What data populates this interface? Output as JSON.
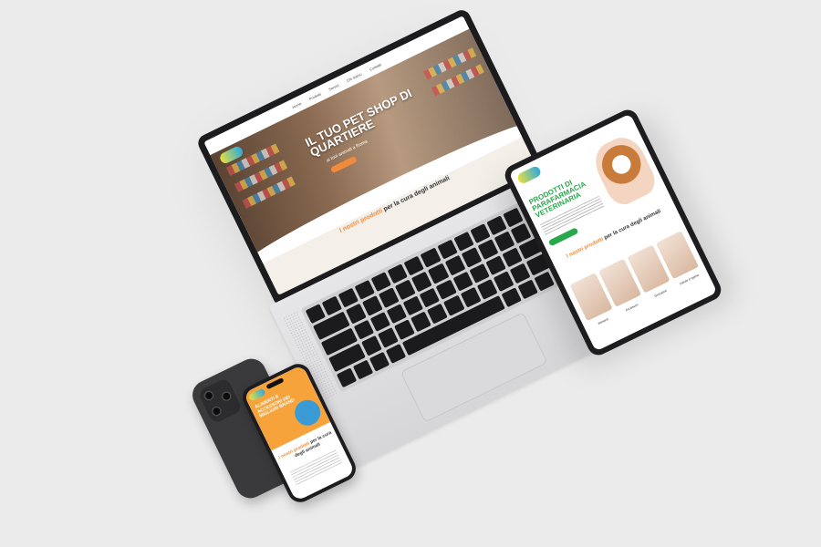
{
  "laptop": {
    "nav_items": [
      "Home",
      "Prodotti",
      "Servizi",
      "Chi siamo",
      "Contatti"
    ],
    "hero_title": "IL TUO PET SHOP DI QUARTIERE",
    "hero_subtitle": "ai tuoi animali a Roma",
    "products_accent": "I nostri prodotti",
    "products_rest": " per la cura degli animali"
  },
  "tablet": {
    "heading": "PRODOTTI DI PARAFARMACIA VETERINARIA",
    "products_accent": "I nostri prodotti",
    "products_rest": " per la cura degli animali",
    "categories": [
      "Alimenti",
      "Accessori",
      "Giocattoli",
      "Salute e igiene"
    ]
  },
  "phone": {
    "heading": "ALIMENTI E ACCESSORI DEI MIGLIORI BRAND",
    "products_accent": "I nostri prodotti",
    "products_rest": " per la cura degli animali"
  },
  "colors": {
    "background": "#ebebeb",
    "accent_orange": "#f28a3c",
    "accent_green": "#27a84a",
    "device_dark": "#1d1d1f"
  }
}
